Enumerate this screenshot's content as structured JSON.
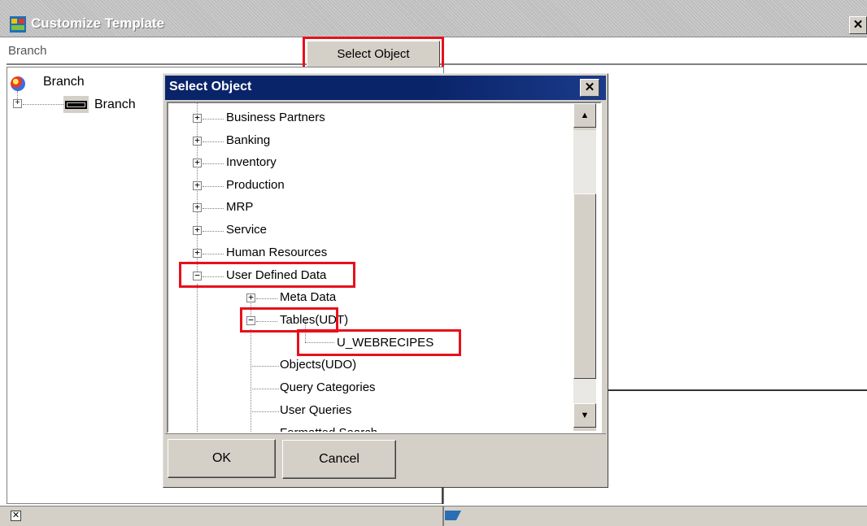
{
  "window": {
    "title": "Customize Template",
    "close_glyph": "✕"
  },
  "toolbar": {
    "branch_field_value": "Branch",
    "select_object_label": "Select Object"
  },
  "left_tree": {
    "root_label": "Branch",
    "child_label": "Branch",
    "expander": "+"
  },
  "status_bar": {
    "close_glyph": "✕"
  },
  "dialog": {
    "title": "Select Object",
    "close_glyph": "✕",
    "tree": {
      "top_items": [
        {
          "label": "Business Partners",
          "expander": "+"
        },
        {
          "label": "Banking",
          "expander": "+"
        },
        {
          "label": "Inventory",
          "expander": "+"
        },
        {
          "label": "Production",
          "expander": "+"
        },
        {
          "label": "MRP",
          "expander": "+"
        },
        {
          "label": "Service",
          "expander": "+"
        },
        {
          "label": "Human Resources",
          "expander": "+"
        },
        {
          "label": "User Defined Data",
          "expander": "−"
        }
      ],
      "udd_children": [
        {
          "label": "Meta Data",
          "expander": "+"
        },
        {
          "label": "Tables(UDT)",
          "expander": "−"
        },
        {
          "label": "U_WEBRECIPES",
          "expander": ""
        },
        {
          "label": "Objects(UDO)",
          "expander": ""
        },
        {
          "label": "Query Categories",
          "expander": ""
        },
        {
          "label": "User Queries",
          "expander": ""
        },
        {
          "label": "Formatted Search",
          "expander": ""
        }
      ]
    },
    "scroll_up_glyph": "▲",
    "scroll_down_glyph": "▼",
    "ok_label": "OK",
    "cancel_label": "Cancel"
  },
  "highlight_color": "#e8101b",
  "dialog_title_color": "#0a246a"
}
